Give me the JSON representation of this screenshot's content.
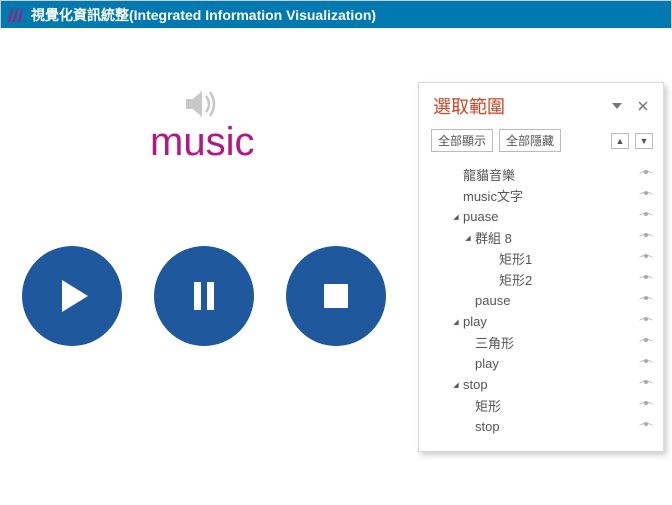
{
  "titlebar": {
    "title": "視覺化資訊統整(Integrated Information Visualization)"
  },
  "stage": {
    "music_label": "music"
  },
  "pane": {
    "title": "選取範圍",
    "show_all": "全部顯示",
    "hide_all": "全部隱藏",
    "tree": [
      {
        "label": "龍貓音樂",
        "indent": 2,
        "toggle": ""
      },
      {
        "label": "music文字",
        "indent": 2,
        "toggle": ""
      },
      {
        "label": "puase",
        "indent": 2,
        "toggle": "▾"
      },
      {
        "label": "群組 8",
        "indent": 3,
        "toggle": "▾"
      },
      {
        "label": "矩形1",
        "indent": 5,
        "toggle": ""
      },
      {
        "label": "矩形2",
        "indent": 5,
        "toggle": ""
      },
      {
        "label": "pause",
        "indent": 3,
        "toggle": ""
      },
      {
        "label": "play",
        "indent": 2,
        "toggle": "▾"
      },
      {
        "label": "三角形",
        "indent": 3,
        "toggle": ""
      },
      {
        "label": "play",
        "indent": 3,
        "toggle": ""
      },
      {
        "label": "stop",
        "indent": 2,
        "toggle": "▾"
      },
      {
        "label": "矩形",
        "indent": 3,
        "toggle": ""
      },
      {
        "label": "stop",
        "indent": 3,
        "toggle": ""
      }
    ]
  }
}
